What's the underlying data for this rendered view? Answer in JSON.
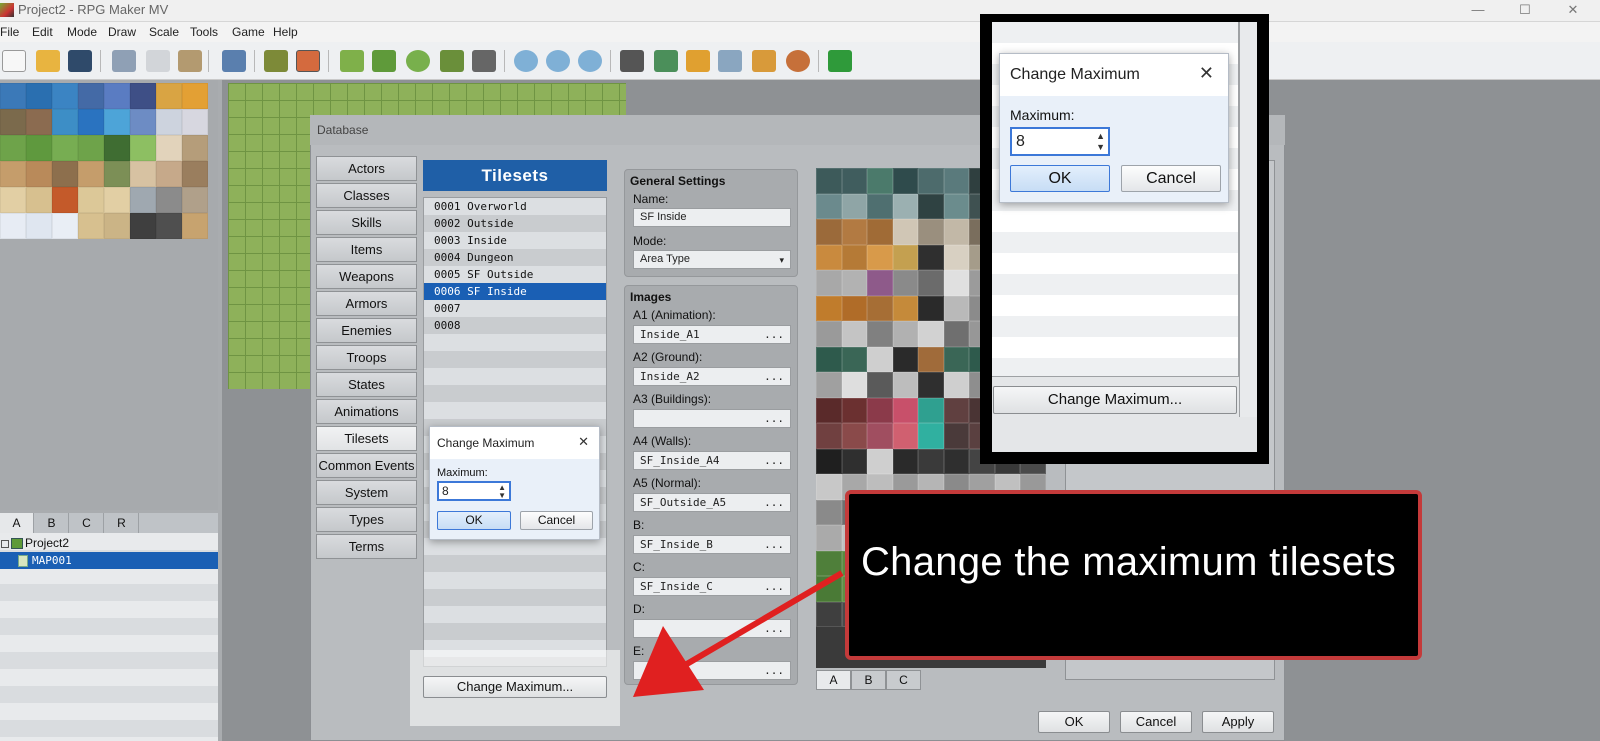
{
  "window": {
    "title": "Project2 - RPG Maker MV",
    "minimize": "—",
    "maximize": "☐",
    "close": "✕"
  },
  "menu": [
    "File",
    "Edit",
    "Mode",
    "Draw",
    "Scale",
    "Tools",
    "Game",
    "Help"
  ],
  "toolbar_icons": [
    "new-project-icon",
    "open-project-icon",
    "save-project-icon",
    "cut-icon",
    "copy-icon",
    "paste-icon",
    "undo-icon",
    "map-mode-icon",
    "event-mode-icon",
    "pencil-icon",
    "rectangle-icon",
    "ellipse-icon",
    "fill-icon",
    "shadow-pen-icon",
    "zoom-in-icon",
    "zoom-out-icon",
    "actual-size-icon",
    "database-icon",
    "plugin-manager-icon",
    "sound-test-icon",
    "event-searcher-icon",
    "resource-manager-icon",
    "character-generator-icon",
    "playtest-icon"
  ],
  "left": {
    "tabs": [
      "A",
      "B",
      "C",
      "R"
    ],
    "tree": [
      {
        "label": "Project2"
      },
      {
        "label": "MAP001"
      }
    ]
  },
  "database": {
    "title": "Database",
    "nav": [
      "Actors",
      "Classes",
      "Skills",
      "Items",
      "Weapons",
      "Armors",
      "Enemies",
      "Troops",
      "States",
      "Animations",
      "Tilesets",
      "Common Events",
      "System",
      "Types",
      "Terms"
    ],
    "active_nav": "Tilesets",
    "list_header": "Tilesets",
    "tilesets": [
      "0001 Overworld",
      "0002 Outside",
      "0003 Inside",
      "0004 Dungeon",
      "0005 SF Outside",
      "0006 SF Inside",
      "0007",
      "0008"
    ],
    "selected_index": 5,
    "change_max_button": "Change Maximum...",
    "general": {
      "heading": "General Settings",
      "name_label": "Name:",
      "name_value": "SF Inside",
      "mode_label": "Mode:",
      "mode_value": "Area Type"
    },
    "images": {
      "heading": "Images",
      "fields": [
        {
          "label": "A1 (Animation):",
          "value": "Inside_A1"
        },
        {
          "label": "A2 (Ground):",
          "value": "Inside_A2"
        },
        {
          "label": "A3 (Buildings):",
          "value": ""
        },
        {
          "label": "A4 (Walls):",
          "value": "SF_Inside_A4"
        },
        {
          "label": "A5 (Normal):",
          "value": "SF_Outside_A5"
        },
        {
          "label": "B:",
          "value": "SF_Inside_B"
        },
        {
          "label": "C:",
          "value": "SF_Inside_C"
        },
        {
          "label": "D:",
          "value": ""
        },
        {
          "label": "E:",
          "value": ""
        }
      ],
      "ellipsis": "..."
    },
    "preview_tabs": [
      "A",
      "B",
      "C"
    ],
    "footer": {
      "ok": "OK",
      "cancel": "Cancel",
      "apply": "Apply"
    }
  },
  "dialog": {
    "title": "Change Maximum",
    "close": "✕",
    "label": "Maximum:",
    "value": "8",
    "spin_up": "▲",
    "spin_down": "▼",
    "ok": "OK",
    "cancel": "Cancel"
  },
  "callout": {
    "text": "Change the maximum tilesets",
    "border_color": "#c43a3a",
    "arrow_color": "#e02020"
  },
  "colors": {
    "selection": "#1a5fb4",
    "header": "#1f5fa7"
  }
}
